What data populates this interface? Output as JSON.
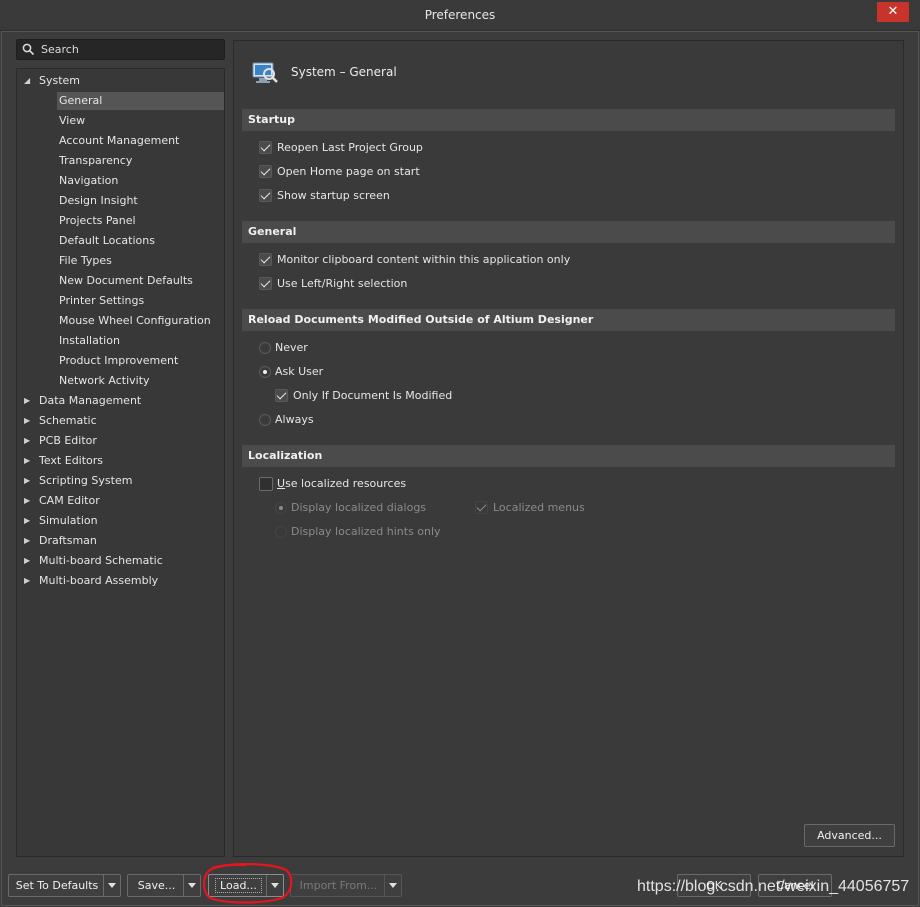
{
  "window": {
    "title": "Preferences",
    "close_label": "✕"
  },
  "search": {
    "label": "Search"
  },
  "tree": {
    "system_label": "System",
    "system_children": [
      "General",
      "View",
      "Account Management",
      "Transparency",
      "Navigation",
      "Design Insight",
      "Projects Panel",
      "Default Locations",
      "File Types",
      "New Document Defaults",
      "Printer Settings",
      "Mouse Wheel Configuration",
      "Installation",
      "Product Improvement",
      "Network Activity"
    ],
    "selected_child": "General",
    "other_items": [
      "Data Management",
      "Schematic",
      "PCB Editor",
      "Text Editors",
      "Scripting System",
      "CAM Editor",
      "Simulation",
      "Draftsman",
      "Multi-board Schematic",
      "Multi-board Assembly"
    ]
  },
  "page": {
    "title": "System – General",
    "startup": {
      "header": "Startup",
      "options": [
        {
          "label": "Reopen Last Project Group",
          "checked": true
        },
        {
          "label": "Open Home page on start",
          "checked": true
        },
        {
          "label": "Show startup screen",
          "checked": true
        }
      ]
    },
    "general": {
      "header": "General",
      "options": [
        {
          "label": "Monitor clipboard content within this application only",
          "checked": true
        },
        {
          "label": "Use Left/Right selection",
          "checked": true
        }
      ]
    },
    "reload": {
      "header": "Reload Documents Modified Outside of Altium Designer",
      "never": "Never",
      "ask_user": "Ask User",
      "only_if_modified": "Only If Document Is Modified",
      "always": "Always",
      "selected": "Ask User",
      "only_if_modified_checked": true
    },
    "localization": {
      "header": "Localization",
      "use_localized_u": "U",
      "use_localized_rest": "se localized resources",
      "use_localized_checked": false,
      "display_dialogs": "Display localized dialogs",
      "localized_menus": "Localized menus",
      "display_hints": "Display localized hints only"
    },
    "advanced_label": "Advanced..."
  },
  "footer": {
    "set_defaults": "Set To Defaults",
    "save": "Save...",
    "load": "Load...",
    "import_from": "Import From...",
    "ok": "OK",
    "cancel": "Cancel"
  },
  "watermark": "https://blog.csdn.net/weixin_44056757",
  "colors": {
    "background": "#3c3c3c",
    "close": "#c8342b",
    "annotation": "#e8141e"
  }
}
